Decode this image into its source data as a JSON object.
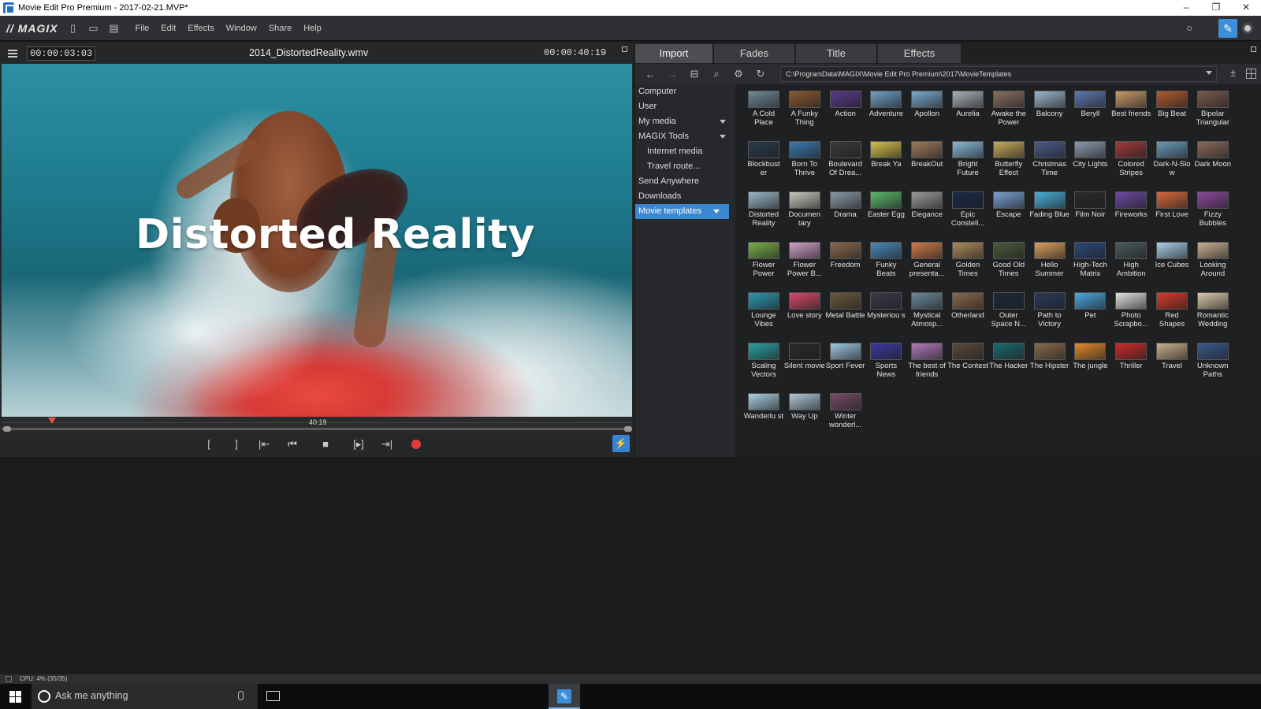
{
  "window": {
    "title": "Movie Edit Pro Premium - 2017-02-21.MVP*",
    "controls": [
      "–",
      "❐",
      "✕"
    ]
  },
  "menubar": {
    "logo": "// MAGIX",
    "menus": [
      "File",
      "Edit",
      "Effects",
      "Window",
      "Share",
      "Help"
    ]
  },
  "monitor": {
    "timecode_left": "00:00:03:03",
    "filename": "2014_DistortedReality.wmv",
    "timecode_right": "00:00:40:19",
    "video_title": "Distorted Reality",
    "scrub_label": "40:19",
    "playhead_position_fraction": 0.08
  },
  "transport": [
    "[",
    "]",
    "|⇤",
    "⏮",
    "■",
    "[▸]",
    "⇥|",
    "●",
    "⚡"
  ],
  "media": {
    "tabs": [
      "Import",
      "Fades",
      "Title",
      "Effects"
    ],
    "active_tab": "Import",
    "path": "C:\\ProgramData\\MAGIX\\Movie Edit Pro Premium\\2017\\MovieTemplates",
    "sidebar": [
      {
        "label": "Computer",
        "sub": false,
        "arrow": false,
        "selected": false
      },
      {
        "label": "User",
        "sub": false,
        "arrow": false,
        "selected": false
      },
      {
        "label": "My media",
        "sub": false,
        "arrow": true,
        "selected": false
      },
      {
        "label": "MAGIX Tools",
        "sub": false,
        "arrow": true,
        "selected": false
      },
      {
        "label": "Internet media",
        "sub": true,
        "arrow": false,
        "selected": false
      },
      {
        "label": "Travel route...",
        "sub": true,
        "arrow": false,
        "selected": false
      },
      {
        "label": "Send Anywhere",
        "sub": false,
        "arrow": false,
        "selected": false
      },
      {
        "label": "Downloads",
        "sub": false,
        "arrow": false,
        "selected": false
      },
      {
        "label": "Movie templates",
        "sub": false,
        "arrow": true,
        "selected": true
      }
    ],
    "templates": [
      {
        "name": "A Cold Place",
        "color": "#6f8a9a"
      },
      {
        "name": "A Funky Thing",
        "color": "#8a5a30"
      },
      {
        "name": "Action",
        "color": "#5a3a8a"
      },
      {
        "name": "Adventure",
        "color": "#6f9fc4"
      },
      {
        "name": "Apollon",
        "color": "#7aaad0"
      },
      {
        "name": "Aurelia",
        "color": "#a8b0b8"
      },
      {
        "name": "Awake the Power",
        "color": "#8a7060"
      },
      {
        "name": "Balcony",
        "color": "#9ab8d0"
      },
      {
        "name": "Beryll",
        "color": "#5a7ab0"
      },
      {
        "name": "Best friends",
        "color": "#c79a6a"
      },
      {
        "name": "Big Beat",
        "color": "#b05a30"
      },
      {
        "name": "Bipolar Triangular",
        "color": "#7a5a4a"
      },
      {
        "name": "Blockbust er",
        "color": "#2a3a4a"
      },
      {
        "name": "Born To Thrive",
        "color": "#3a7ab0"
      },
      {
        "name": "Boulevard Of Drea...",
        "color": "#3a3a3a"
      },
      {
        "name": "Break Ya",
        "color": "#d6c24a"
      },
      {
        "name": "BreakOut",
        "color": "#a07a5a"
      },
      {
        "name": "Bright Future",
        "color": "#8ab8d8"
      },
      {
        "name": "Butterfly Effect",
        "color": "#c8aa5a"
      },
      {
        "name": "Christmas Time",
        "color": "#4a5a8a"
      },
      {
        "name": "City Lights",
        "color": "#8a9aaa"
      },
      {
        "name": "Colored Stripes",
        "color": "#a03a3a"
      },
      {
        "name": "Dark-N-Slo w",
        "color": "#6a9ab8"
      },
      {
        "name": "Dark Moon",
        "color": "#8a6a5a"
      },
      {
        "name": "Distorted Reality",
        "color": "#9ab8c8"
      },
      {
        "name": "Documen tary",
        "color": "#c8c8c0"
      },
      {
        "name": "Drama",
        "color": "#8a9aa8"
      },
      {
        "name": "Easter Egg",
        "color": "#5ab86a"
      },
      {
        "name": "Elegance",
        "color": "#9a9a9a"
      },
      {
        "name": "Epic Constell...",
        "color": "#1a2a4a"
      },
      {
        "name": "Escape",
        "color": "#7aa0d0"
      },
      {
        "name": "Fading Blue",
        "color": "#4ab0d8"
      },
      {
        "name": "Film Noir",
        "color": "#2a2a2a"
      },
      {
        "name": "Fireworks",
        "color": "#6a4aa0"
      },
      {
        "name": "First Love",
        "color": "#d86a3a"
      },
      {
        "name": "Fizzy Bubbles",
        "color": "#8a4a9a"
      },
      {
        "name": "Flower Power",
        "color": "#7ab04a"
      },
      {
        "name": "Flower Power B...",
        "color": "#d0a0c8"
      },
      {
        "name": "Freedom",
        "color": "#8a6a4a"
      },
      {
        "name": "Funky Beats",
        "color": "#4a8ab8"
      },
      {
        "name": "General presenta...",
        "color": "#d07a4a"
      },
      {
        "name": "Golden Times",
        "color": "#b08a5a"
      },
      {
        "name": "Good Old Times",
        "color": "#4a5a3a"
      },
      {
        "name": "Hello Summer",
        "color": "#d8a05a"
      },
      {
        "name": "High-Tech Matrix",
        "color": "#2a4a7a"
      },
      {
        "name": "High Ambition",
        "color": "#4a5a5a"
      },
      {
        "name": "Ice Cubes",
        "color": "#a8d0e8"
      },
      {
        "name": "Looking Around",
        "color": "#c8b090"
      },
      {
        "name": "Lounge Vibes",
        "color": "#2a9ab0"
      },
      {
        "name": "Love story",
        "color": "#d84a6a"
      },
      {
        "name": "Metal Battle",
        "color": "#6a5a3a"
      },
      {
        "name": "Mysteriou s",
        "color": "#3a3a4a"
      },
      {
        "name": "Mystical Atmosp...",
        "color": "#6a8a9a"
      },
      {
        "name": "Otherland",
        "color": "#8a6a4a"
      },
      {
        "name": "Outer Space N...",
        "color": "#1a2a3a"
      },
      {
        "name": "Path to Victory",
        "color": "#2a3a5a"
      },
      {
        "name": "Pet",
        "color": "#4aa8e0"
      },
      {
        "name": "Photo Scrapbo...",
        "color": "#e0e0e0"
      },
      {
        "name": "Red Shapes",
        "color": "#d83a2a"
      },
      {
        "name": "Romantic Wedding",
        "color": "#d8c8a8"
      },
      {
        "name": "Scaling Vectors",
        "color": "#2aa0a0"
      },
      {
        "name": "Silent movie",
        "color": "#2a2a2a"
      },
      {
        "name": "Sport Fever",
        "color": "#a0c8e0"
      },
      {
        "name": "Sports News",
        "color": "#3a3aa0"
      },
      {
        "name": "The best of friends",
        "color": "#b07ab8"
      },
      {
        "name": "The Contest",
        "color": "#5a4a3a"
      },
      {
        "name": "The Hacker",
        "color": "#1a6a6a"
      },
      {
        "name": "The Hipster",
        "color": "#8a6a4a"
      },
      {
        "name": "The jungle",
        "color": "#e08a2a"
      },
      {
        "name": "Thriller",
        "color": "#c82a2a"
      },
      {
        "name": "Travel",
        "color": "#c8b08a"
      },
      {
        "name": "Unknown Paths",
        "color": "#3a5a8a"
      },
      {
        "name": "Wanderlu st",
        "color": "#a8d0e0"
      },
      {
        "name": "Way Up",
        "color": "#b0c8d8"
      },
      {
        "name": "Winter wonderl...",
        "color": "#7a4a6a"
      }
    ]
  },
  "statusbar": {
    "text": "CPU: 4% (35/35)"
  },
  "taskbar": {
    "search_placeholder": "Ask me anything"
  }
}
